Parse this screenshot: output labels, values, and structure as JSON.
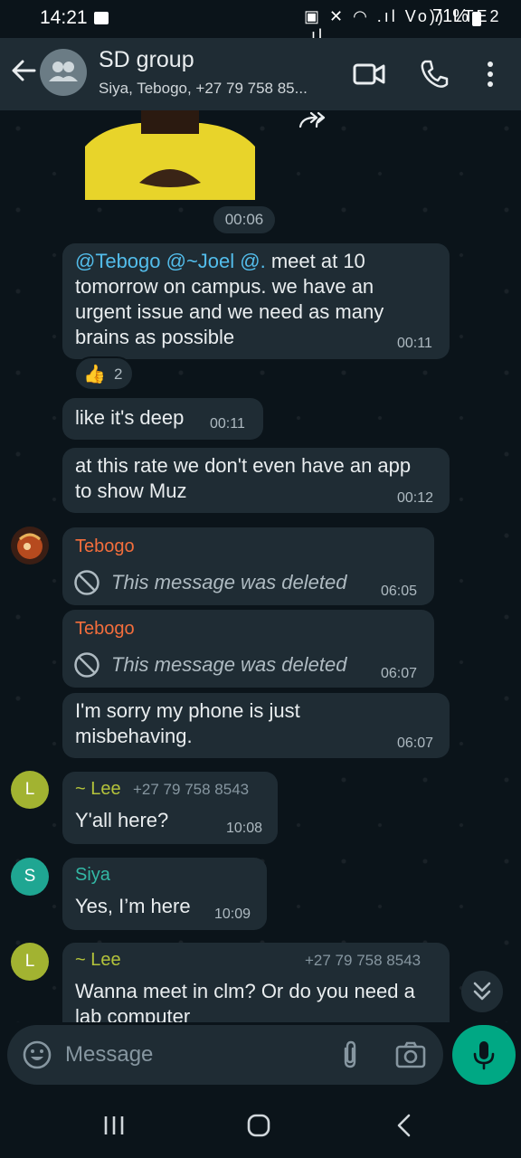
{
  "status_bar": {
    "time": "14:21",
    "indicators": "▣ ✕ ◠ .ıl Vo)) LTE2 .ıl",
    "battery": "71%"
  },
  "header": {
    "title": "SD group",
    "subtitle": "Siya, Tebogo, +27 79 758 85...",
    "icons": [
      "back-arrow-icon",
      "group-avatar-icon",
      "video-call-icon",
      "voice-call-icon",
      "more-options-icon"
    ]
  },
  "chat": {
    "image_time": "00:06",
    "messages": [
      {
        "id": "m1",
        "mention_text": "@Tebogo @~Joel @.",
        "line1_rest": " meet at 10",
        "line2": "tomorrow on campus. we have an",
        "line3": "urgent issue and we need as many",
        "line4": "brains as possible",
        "time": "00:11",
        "reaction": {
          "emoji": "👍",
          "count": "2"
        }
      },
      {
        "id": "m2",
        "text": "like it's deep",
        "time": "00:11"
      },
      {
        "id": "m3",
        "line1": "at this rate we don't even have an app",
        "line2": "to show Muz",
        "time": "00:12"
      },
      {
        "id": "m4",
        "sender": "Tebogo",
        "text": "This message was deleted",
        "time": "06:05",
        "deleted": true
      },
      {
        "id": "m5",
        "sender": "Tebogo",
        "text": "This message was deleted",
        "time": "06:07",
        "deleted": true
      },
      {
        "id": "m6",
        "line1": "I'm sorry my phone is just",
        "line2": "misbehaving.",
        "time": "06:07"
      },
      {
        "id": "m7",
        "sender": "~ Lee",
        "phone": "+27 79 758 8543",
        "avatar_letter": "L",
        "text": "Y'all here?",
        "time": "10:08"
      },
      {
        "id": "m8",
        "sender": "Siya",
        "avatar_letter": "S",
        "text": "Yes, I’m here",
        "time": "10:09"
      },
      {
        "id": "m9",
        "sender": "~ Lee",
        "phone": "+27 79 758 8543",
        "avatar_letter": "L",
        "line1": "Wanna meet in clm? Or do you need a",
        "line2": "lab computer"
      }
    ]
  },
  "input": {
    "placeholder": "Message"
  },
  "colors": {
    "background": "#0b141a",
    "bubble": "#1f2c34",
    "accent": "#00a884",
    "tebogo_name": "#f46e3c",
    "lee_name": "#b4c33b",
    "siya_name": "#33b8a5",
    "mention": "#53bdeb"
  }
}
